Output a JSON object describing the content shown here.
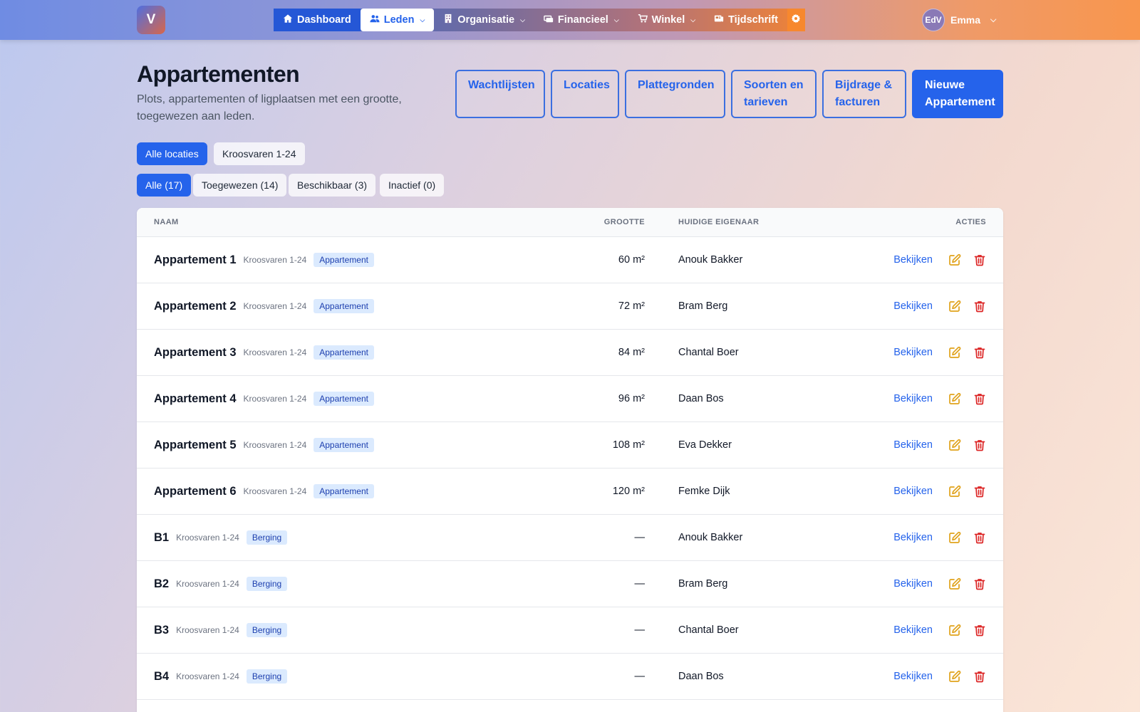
{
  "brand": {
    "logo_letter": "V"
  },
  "nav": {
    "items": [
      {
        "label": "Dashboard",
        "icon": "home-icon",
        "has_dropdown": false
      },
      {
        "label": "Leden",
        "icon": "users-icon",
        "has_dropdown": true
      },
      {
        "label": "Organisatie",
        "icon": "building-icon",
        "has_dropdown": true
      },
      {
        "label": "Financieel",
        "icon": "money-icon",
        "has_dropdown": true
      },
      {
        "label": "Winkel",
        "icon": "cart-icon",
        "has_dropdown": true
      },
      {
        "label": "Tijdschrift",
        "icon": "magazine-icon",
        "has_dropdown": false
      }
    ],
    "selected": "Leden",
    "settings_icon": "gear-icon"
  },
  "user": {
    "initials": "EdV",
    "name": "Emma"
  },
  "page": {
    "title": "Appartementen",
    "subtitle": "Plots, appartementen of ligplaatsen met een grootte, toegewezen aan leden."
  },
  "header_buttons": [
    {
      "label": "Wachtlijsten"
    },
    {
      "label": "Locaties"
    },
    {
      "label": "Plattegronden"
    },
    {
      "label": "Soorten en tarieven"
    },
    {
      "label": "Bijdrage & facturen"
    },
    {
      "label": "Nieuwe Appartement"
    }
  ],
  "location_filters": [
    {
      "label": "Alle locaties",
      "active": true
    },
    {
      "label": "Kroosvaren 1-24",
      "active": false
    }
  ],
  "status_filters": [
    {
      "label": "Alle (17)",
      "active": true
    },
    {
      "label": "Toegewezen (14)",
      "active": false
    },
    {
      "label": "Beschikbaar (3)",
      "active": false
    },
    {
      "label": "Inactief (0)",
      "active": false
    }
  ],
  "table": {
    "headers": {
      "name": "NAAM",
      "size": "GROOTTE",
      "owner": "HUIDIGE EIGENAAR",
      "actions": "ACTIES"
    },
    "view_label": "Bekijken",
    "rows": [
      {
        "name": "Appartement 1",
        "location": "Kroosvaren 1-24",
        "type": "Appartement",
        "size": "60 m²",
        "owner": "Anouk Bakker"
      },
      {
        "name": "Appartement 2",
        "location": "Kroosvaren 1-24",
        "type": "Appartement",
        "size": "72 m²",
        "owner": "Bram Berg"
      },
      {
        "name": "Appartement 3",
        "location": "Kroosvaren 1-24",
        "type": "Appartement",
        "size": "84 m²",
        "owner": "Chantal Boer"
      },
      {
        "name": "Appartement 4",
        "location": "Kroosvaren 1-24",
        "type": "Appartement",
        "size": "96 m²",
        "owner": "Daan Bos"
      },
      {
        "name": "Appartement 5",
        "location": "Kroosvaren 1-24",
        "type": "Appartement",
        "size": "108 m²",
        "owner": "Eva Dekker"
      },
      {
        "name": "Appartement 6",
        "location": "Kroosvaren 1-24",
        "type": "Appartement",
        "size": "120 m²",
        "owner": "Femke Dijk"
      },
      {
        "name": "B1",
        "location": "Kroosvaren 1-24",
        "type": "Berging",
        "size": "—",
        "owner": "Anouk Bakker"
      },
      {
        "name": "B2",
        "location": "Kroosvaren 1-24",
        "type": "Berging",
        "size": "—",
        "owner": "Bram Berg"
      },
      {
        "name": "B3",
        "location": "Kroosvaren 1-24",
        "type": "Berging",
        "size": "—",
        "owner": "Chantal Boer"
      },
      {
        "name": "B4",
        "location": "Kroosvaren 1-24",
        "type": "Berging",
        "size": "—",
        "owner": "Daan Bos"
      }
    ]
  },
  "colors": {
    "primary": "#2563eb",
    "edit_icon": "#e0a21b",
    "delete_icon": "#dc2626",
    "badge_bg": "#dbeafe",
    "badge_text": "#1e40af"
  }
}
